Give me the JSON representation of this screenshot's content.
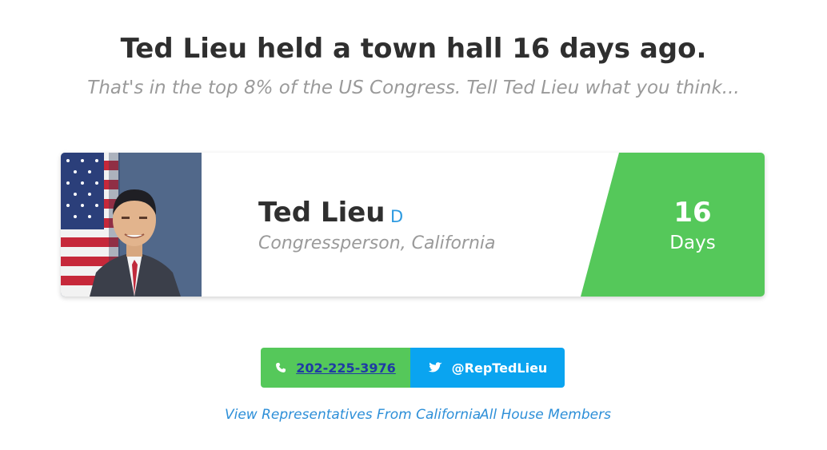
{
  "header": {
    "headline": "Ted Lieu held a town hall 16 days ago.",
    "subline": "That's in the top 8% of the US Congress. Tell Ted Lieu what you think..."
  },
  "card": {
    "name": "Ted Lieu",
    "party": "D",
    "role": "Congressperson, California",
    "days_number": "16",
    "days_label": "Days",
    "accent_color": "#55c85a",
    "party_color": "#2d9ae0"
  },
  "actions": {
    "phone": {
      "label": "202-225-3976",
      "icon": "phone-icon",
      "color": "#55c85a"
    },
    "twitter": {
      "label": "@RepTedLieu",
      "icon": "twitter-icon",
      "color": "#0aa4f0"
    }
  },
  "links": {
    "state": "View Representatives From California",
    "house": "All House Members"
  }
}
